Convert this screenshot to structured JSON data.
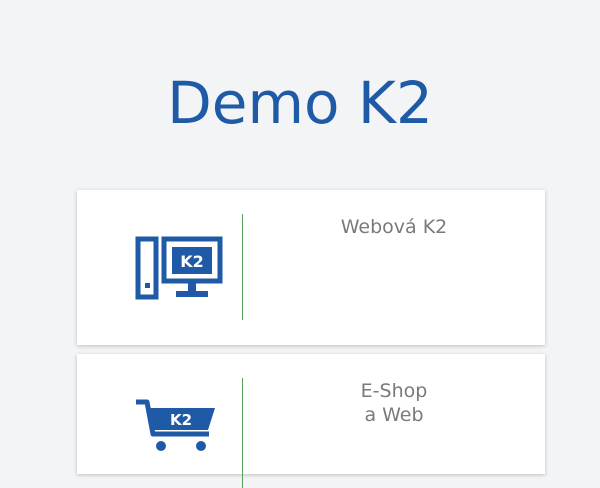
{
  "page": {
    "title": "Demo K2"
  },
  "cards": [
    {
      "label": "Webová K2",
      "icon": "desktop-computer-k2-icon",
      "icon_text": "K2"
    },
    {
      "label": "E-Shop\na Web",
      "icon": "shopping-cart-k2-icon",
      "icon_text": "K2"
    }
  ],
  "colors": {
    "brand_blue": "#1f5aa6",
    "divider_green": "#5aa05a",
    "label_gray": "#7a7a7a",
    "background": "#f3f4f6"
  }
}
